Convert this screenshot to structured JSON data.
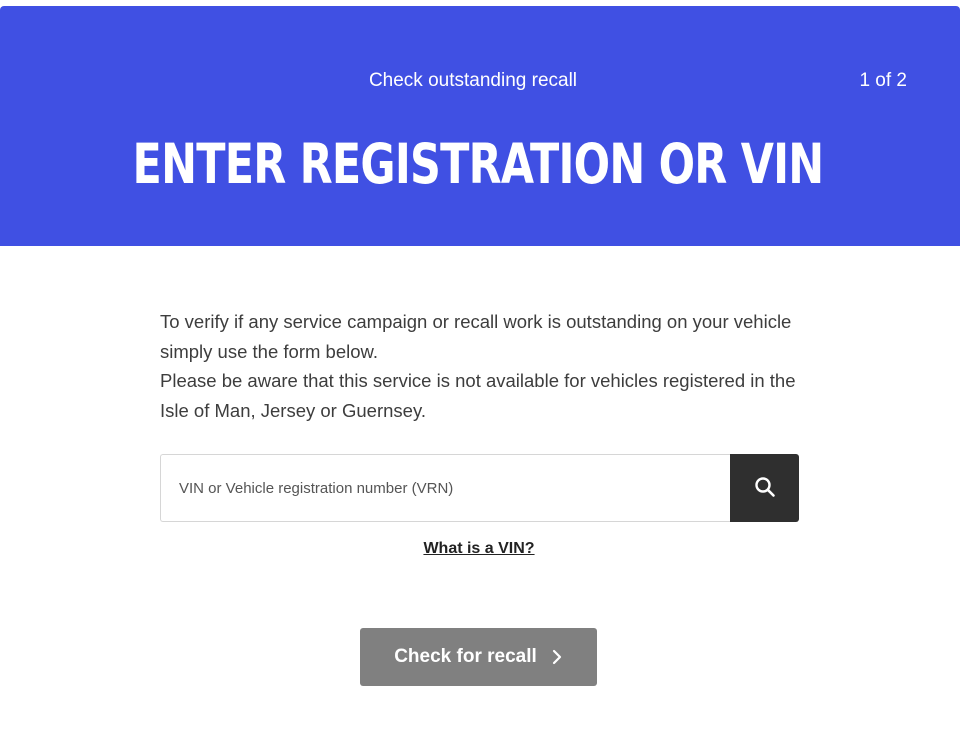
{
  "header": {
    "step_title": "Check outstanding recall",
    "step_counter": "1 of 2",
    "title": "ENTER REGISTRATION OR VIN",
    "background_color": "#4050e3"
  },
  "intro": {
    "line1": "To verify if any service campaign or recall work is outstanding on your vehicle simply use the form below.",
    "line2": "Please be aware that this service is not available for vehicles registered in the Isle of Man, Jersey or Guernsey."
  },
  "search": {
    "placeholder": "VIN or Vehicle registration number (VRN)",
    "value": "",
    "button_icon": "search-icon",
    "button_color": "#2f2f2f"
  },
  "help_link": {
    "label": "What is a VIN?"
  },
  "submit": {
    "label": "Check for recall",
    "icon": "chevron-right-icon",
    "color": "#808080"
  }
}
